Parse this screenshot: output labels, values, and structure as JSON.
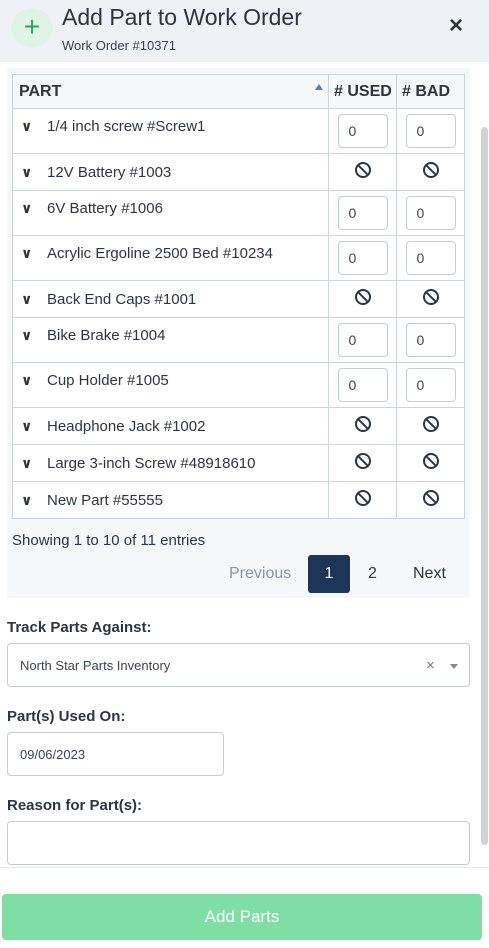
{
  "header": {
    "title": "Add Part to Work Order",
    "subtitle": "Work Order #10371",
    "add_icon": "plus-icon",
    "close_icon": "close-icon",
    "close_glyph": "×",
    "plus_glyph": "+"
  },
  "table": {
    "columns": [
      "PART",
      "# USED",
      "# BAD"
    ],
    "rows": [
      {
        "part": "1/4 inch screw #Screw1",
        "used": "0",
        "bad": "0",
        "editable": true
      },
      {
        "part": "12V Battery #1003",
        "used": "",
        "bad": "",
        "editable": false
      },
      {
        "part": "6V Battery #1006",
        "used": "0",
        "bad": "0",
        "editable": true
      },
      {
        "part": "Acrylic Ergoline 2500 Bed #10234",
        "used": "0",
        "bad": "0",
        "editable": true
      },
      {
        "part": "Back End Caps #1001",
        "used": "",
        "bad": "",
        "editable": false
      },
      {
        "part": "Bike Brake #1004",
        "used": "0",
        "bad": "0",
        "editable": true
      },
      {
        "part": "Cup Holder #1005",
        "used": "0",
        "bad": "0",
        "editable": true
      },
      {
        "part": "Headphone Jack #1002",
        "used": "",
        "bad": "",
        "editable": false
      },
      {
        "part": "Large 3-inch Screw #48918610",
        "used": "",
        "bad": "",
        "editable": false
      },
      {
        "part": "New Part #55555",
        "used": "",
        "bad": "",
        "editable": false
      }
    ]
  },
  "pagination": {
    "showing": "Showing 1 to 10 of 11 entries",
    "previous": "Previous",
    "page1": "1",
    "page2": "2",
    "next": "Next"
  },
  "form": {
    "track_label": "Track Parts Against:",
    "track_value": "North Star Parts Inventory",
    "clear_glyph": "×",
    "used_on_label": "Part(s) Used On:",
    "used_on_value": "09/06/2023",
    "reason_label": "Reason for Part(s):",
    "reason_value": ""
  },
  "footer": {
    "add_parts": "Add Parts"
  },
  "colors": {
    "accent": "#1d3557",
    "add_button": "#7fdea4",
    "plus_icon": "#2ea55f"
  }
}
